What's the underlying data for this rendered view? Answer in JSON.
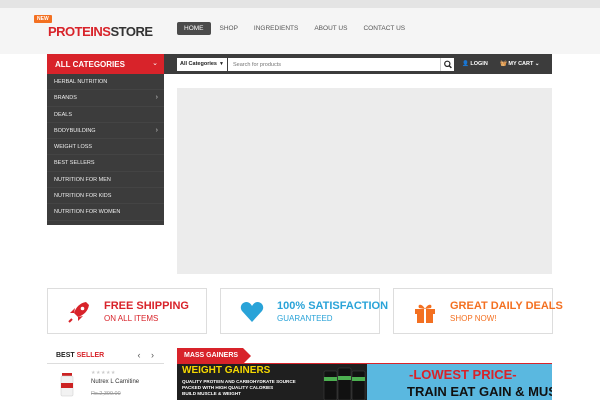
{
  "logo": {
    "part1": "PROTEINS",
    "part2": "STORE"
  },
  "nav": {
    "items": [
      {
        "label": "HOME"
      },
      {
        "label": "SHOP"
      },
      {
        "label": "INGREDIENTS"
      },
      {
        "label": "ABOUT US"
      },
      {
        "label": "CONTACT US"
      }
    ],
    "badge": "NEW"
  },
  "categories": {
    "title": "ALL CATEGORIES",
    "items": [
      {
        "label": "HERBAL NUTRITION",
        "arrow": ""
      },
      {
        "label": "BRANDS",
        "arrow": "›"
      },
      {
        "label": "DEALS",
        "arrow": ""
      },
      {
        "label": "BODYBUILDING",
        "arrow": "›"
      },
      {
        "label": "WEIGHT LOSS",
        "arrow": ""
      },
      {
        "label": "BEST SELLERS",
        "arrow": ""
      },
      {
        "label": "NUTRITION FOR MEN",
        "arrow": ""
      },
      {
        "label": "NUTRITION FOR KIDS",
        "arrow": ""
      },
      {
        "label": "NUTRITION FOR WOMEN",
        "arrow": ""
      }
    ]
  },
  "search": {
    "category_selected": "All Categories",
    "placeholder": "Search for products"
  },
  "account": {
    "login_label": "LOGIN",
    "cart_label": "MY CART"
  },
  "features": [
    {
      "title": "FREE SHIPPING",
      "subtitle": "ON ALL ITEMS",
      "color": "#d8232a",
      "icon": "rocket-icon"
    },
    {
      "title": "100% SATISFACTION",
      "subtitle": "GUARANTEED",
      "color": "#29a3d8",
      "icon": "heart-icon"
    },
    {
      "title": "GREAT DAILY DEALS",
      "subtitle": "SHOP NOW!",
      "color": "#f37021",
      "icon": "gift-icon"
    }
  ],
  "best_seller": {
    "label_part1": "BEST",
    "label_part2": "SELLER",
    "arrows": "‹ ›",
    "product": {
      "stars": "★★★★★",
      "name": "Nutrex L Carnitine",
      "price": "Rs.2,399.00"
    }
  },
  "mass_gainers": {
    "tab_label": "MASS GAINERS",
    "promo": {
      "heading": "WEIGHT GAINERS",
      "line1": "QUALITY PROTEIN AND CARBOHYDRATE SOURCE",
      "line2": "PACKED WITH HIGH QUALITY CALORIES",
      "line3": "BUILD MUSCLE & WEIGHT",
      "lowest_price": "-LOWEST PRICE-",
      "slogan": "TRAIN EAT GAIN & MUSCLE"
    }
  },
  "colors": {
    "brand_red": "#d8232a",
    "dark": "#3c3c3c",
    "blue": "#29a3d8",
    "orange": "#f37021"
  }
}
